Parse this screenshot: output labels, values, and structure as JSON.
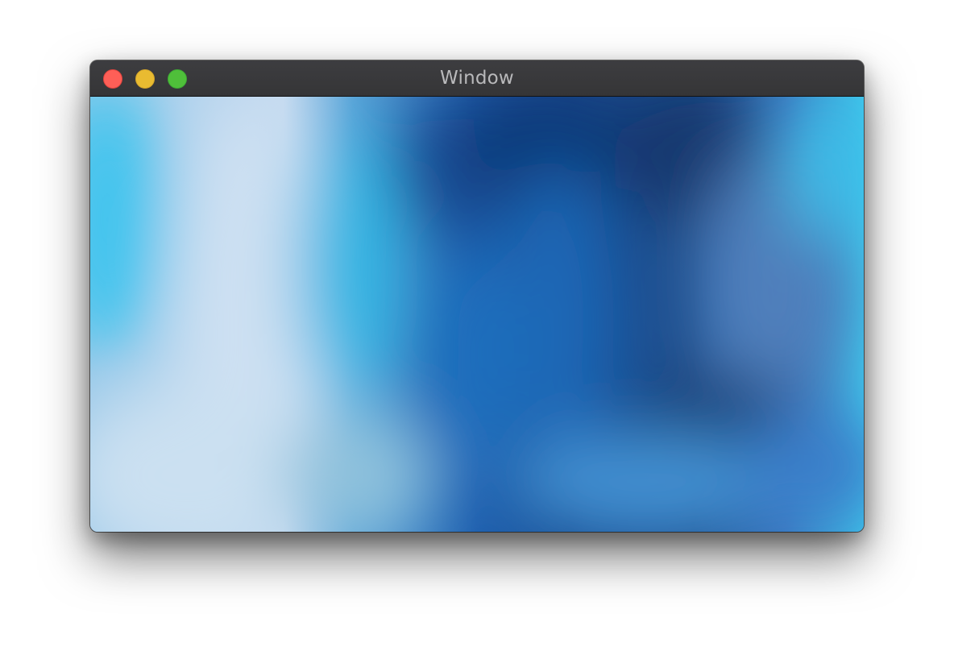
{
  "window": {
    "title": "Window"
  },
  "controls": {
    "close_icon": "close-icon",
    "minimize_icon": "minimize-icon",
    "zoom_icon": "zoom-icon"
  },
  "colors": {
    "close": "#fe5f57",
    "minimize": "#e9bb31",
    "zoom": "#4fbf3a",
    "titlebar": "#39393b",
    "title_text": "#b9b9bb"
  },
  "content": {
    "wallpaper": "blurred-blue-gradient"
  }
}
